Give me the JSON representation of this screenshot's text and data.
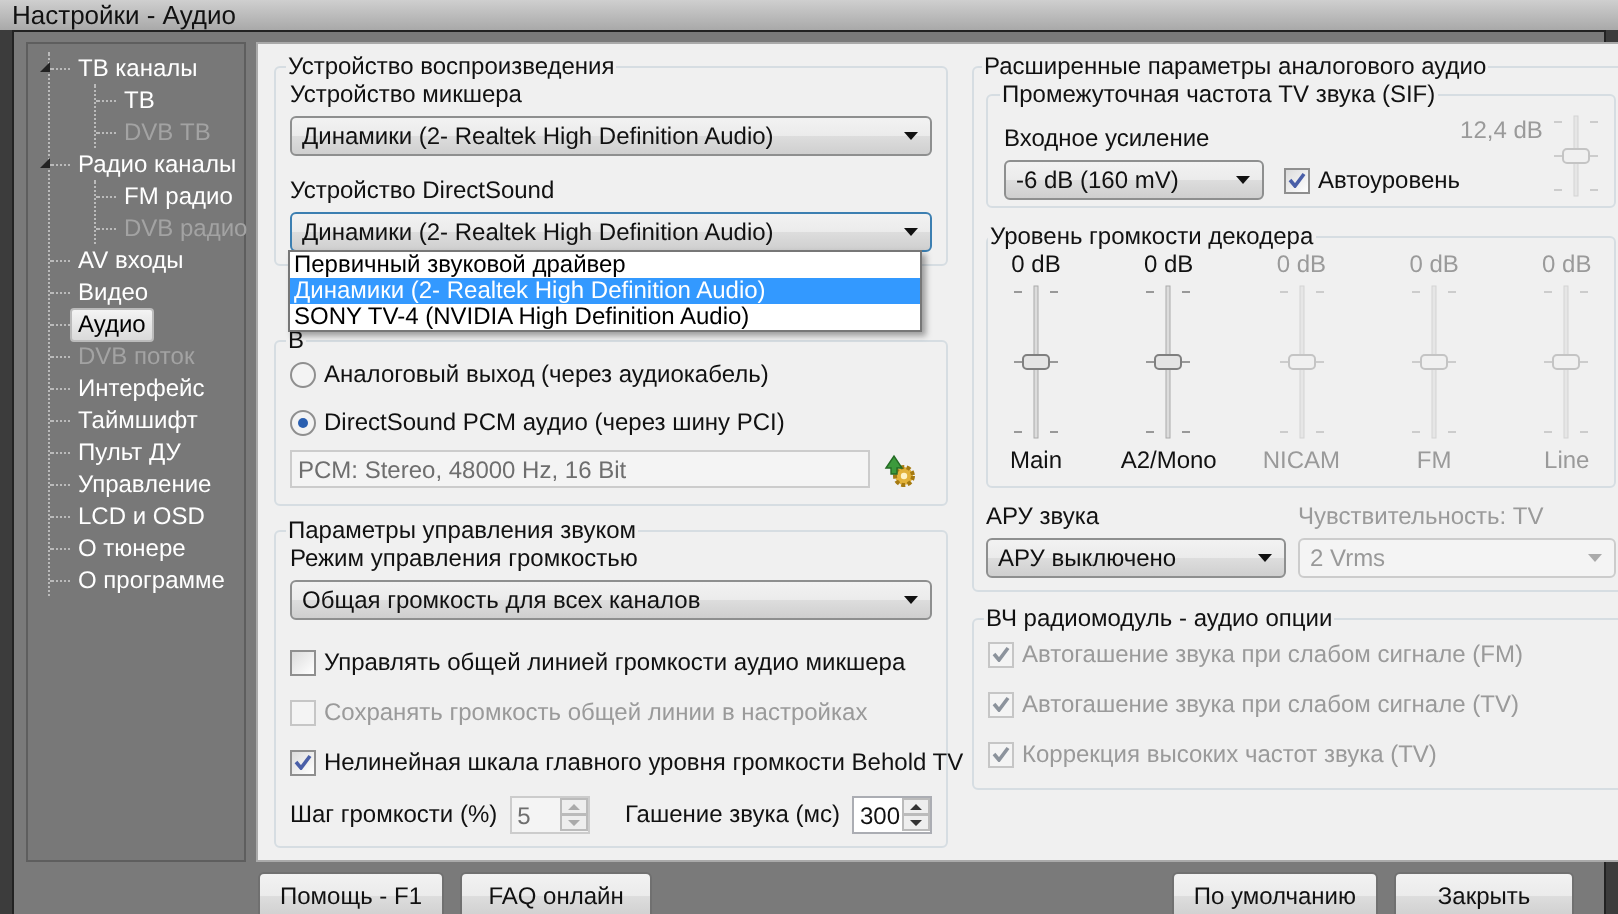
{
  "window": {
    "title": "Настройки - Аудио"
  },
  "sidebar": {
    "items": [
      {
        "label": "ТВ каналы",
        "expanded": true,
        "disabled": false,
        "selected": false,
        "children": [
          {
            "label": "ТВ",
            "disabled": false,
            "selected": false
          },
          {
            "label": "DVB ТВ",
            "disabled": true,
            "selected": false
          }
        ]
      },
      {
        "label": "Радио каналы",
        "expanded": true,
        "disabled": false,
        "selected": false,
        "children": [
          {
            "label": "FM радио",
            "disabled": false,
            "selected": false
          },
          {
            "label": "DVB радио",
            "disabled": true,
            "selected": false
          }
        ]
      },
      {
        "label": "AV входы",
        "disabled": false,
        "selected": false
      },
      {
        "label": "Видео",
        "disabled": false,
        "selected": false
      },
      {
        "label": "Аудио",
        "disabled": false,
        "selected": true
      },
      {
        "label": "DVB поток",
        "disabled": true,
        "selected": false
      },
      {
        "label": "Интерфейс",
        "disabled": false,
        "selected": false
      },
      {
        "label": "Таймшифт",
        "disabled": false,
        "selected": false
      },
      {
        "label": "Пульт ДУ",
        "disabled": false,
        "selected": false
      },
      {
        "label": "Управление",
        "disabled": false,
        "selected": false
      },
      {
        "label": "LCD и OSD",
        "disabled": false,
        "selected": false
      },
      {
        "label": "О тюнере",
        "disabled": false,
        "selected": false
      },
      {
        "label": "О программе",
        "disabled": false,
        "selected": false
      }
    ]
  },
  "playback": {
    "title": "Устройство воспроизведения",
    "mixer_label": "Устройство микшера",
    "mixer_value": "Динамики (2- Realtek High Definition Audio)",
    "directsound_label": "Устройство DirectSound",
    "directsound_value": "Динамики (2- Realtek High Definition Audio)",
    "dropdown_options": [
      {
        "label": "Первичный звуковой драйвер",
        "selected": false
      },
      {
        "label": "Динамики (2- Realtek High Definition Audio)",
        "selected": true
      },
      {
        "label": "SONY TV-4 (NVIDIA High Definition Audio)",
        "selected": false
      }
    ]
  },
  "output": {
    "title": "В",
    "options": [
      {
        "label": "Аналоговый выход (через аудиокабель)",
        "selected": false
      },
      {
        "label": "DirectSound PCM аудио (через шину PCI)",
        "selected": true
      }
    ],
    "format_value": "PCM: Stereo, 48000 Hz, 16 Bit"
  },
  "sound_control": {
    "title": "Параметры управления звуком",
    "mode_label": "Режим управления громкостью",
    "mode_value": "Общая громкость для всех каналов",
    "checkboxes": [
      {
        "label": "Управлять общей линией громкости аудио микшера",
        "checked": false,
        "disabled": false
      },
      {
        "label": "Сохранять громкость общей линии в настройках",
        "checked": false,
        "disabled": true
      },
      {
        "label": "Нелинейная шкала главного уровня громкости Behold TV",
        "checked": true,
        "disabled": false
      }
    ],
    "spinners": [
      {
        "label": "Шаг громкости (%)",
        "value": "5",
        "disabled": true
      },
      {
        "label": "Гашение звука (мс)",
        "value": "300",
        "disabled": false
      }
    ]
  },
  "analog": {
    "title": "Расширенные параметры аналогового аудио",
    "sif": {
      "title": "Промежуточная частота TV звука (SIF)",
      "gain_label": "Входное усиление",
      "gain_value": "-6 dB (160 mV)",
      "auto_label": "Автоуровень",
      "auto_checked": true,
      "reading": "12,4 dB",
      "level": 0.5,
      "disabled": true
    },
    "decoder": {
      "title": "Уровень громкости декодера",
      "channels": [
        {
          "name": "Main",
          "reading": "0 dB",
          "level": 0.5,
          "disabled": false
        },
        {
          "name": "A2/Mono",
          "reading": "0 dB",
          "level": 0.5,
          "disabled": false
        },
        {
          "name": "NICAM",
          "reading": "0 dB",
          "level": 0.5,
          "disabled": true
        },
        {
          "name": "FM",
          "reading": "0 dB",
          "level": 0.5,
          "disabled": true
        },
        {
          "name": "Line",
          "reading": "0 dB",
          "level": 0.5,
          "disabled": true
        }
      ]
    },
    "agc": {
      "label": "АРУ звука",
      "value": "АРУ выключено",
      "disabled": false
    },
    "sensitivity": {
      "label": "Чувствительность: TV",
      "value": "2 Vrms",
      "disabled": true
    }
  },
  "rf": {
    "title": "ВЧ радиомодуль - аудио опции",
    "checkboxes": [
      {
        "label": "Автогашение звука при слабом сигнале (FM)",
        "checked": true,
        "disabled": true
      },
      {
        "label": "Автогашение звука при слабом сигнале (TV)",
        "checked": true,
        "disabled": true
      },
      {
        "label": "Коррекция высоких частот звука (TV)",
        "checked": true,
        "disabled": true
      }
    ]
  },
  "footer": {
    "left_buttons": [
      "Помощь - F1",
      "FAQ онлайн"
    ],
    "right_buttons": [
      "По умолчанию",
      "Закрыть"
    ]
  }
}
